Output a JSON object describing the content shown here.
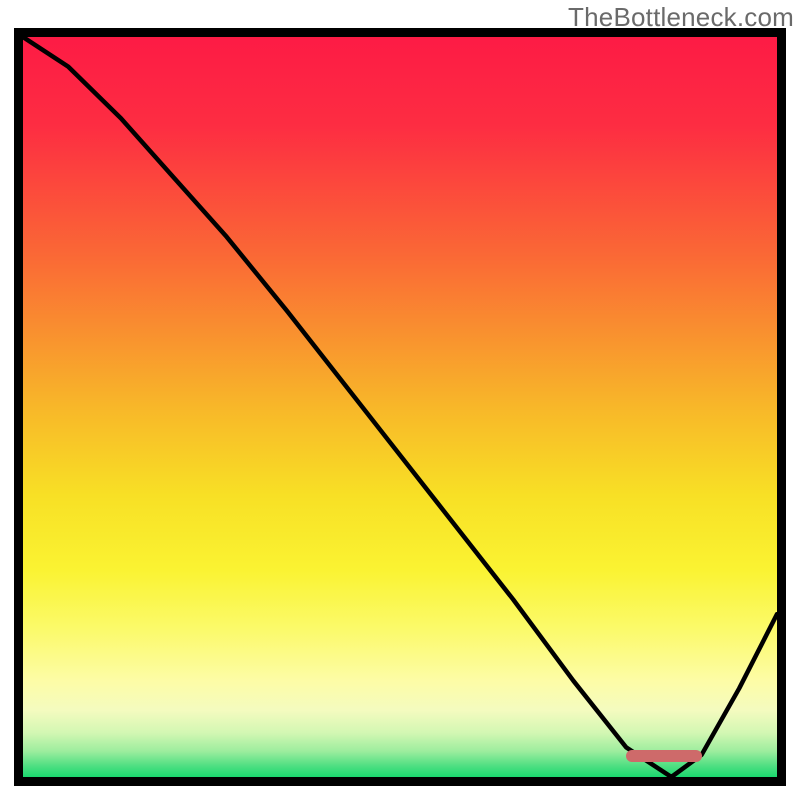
{
  "watermark": "TheBottleneck.com",
  "colors": {
    "frame_border": "#000000",
    "curve_stroke": "#000000",
    "marker_fill": "#ce6a6a",
    "watermark_text": "#6a6a6a"
  },
  "chart_data": {
    "type": "line",
    "title": "",
    "xlabel": "",
    "ylabel": "",
    "xlim": [
      0,
      100
    ],
    "ylim": [
      0,
      100
    ],
    "x": [
      0,
      6,
      13,
      20,
      27,
      35,
      45,
      55,
      65,
      73,
      80,
      86,
      90,
      95,
      100
    ],
    "values": [
      100,
      96,
      89,
      81,
      73,
      63,
      50,
      37,
      24,
      13,
      4,
      0,
      3,
      12,
      22
    ],
    "optimal_range_x": [
      80,
      90
    ],
    "optimal_y_fraction_from_top": 0.972,
    "gradient_stops": [
      {
        "offset": 0.0,
        "color": "#fd1b45"
      },
      {
        "offset": 0.12,
        "color": "#fd2d42"
      },
      {
        "offset": 0.3,
        "color": "#fa6a35"
      },
      {
        "offset": 0.5,
        "color": "#f8b729"
      },
      {
        "offset": 0.62,
        "color": "#f8e025"
      },
      {
        "offset": 0.72,
        "color": "#faf332"
      },
      {
        "offset": 0.8,
        "color": "#fbfa6a"
      },
      {
        "offset": 0.87,
        "color": "#fdfca6"
      },
      {
        "offset": 0.91,
        "color": "#f4fbbf"
      },
      {
        "offset": 0.94,
        "color": "#d3f7b3"
      },
      {
        "offset": 0.965,
        "color": "#9ded9e"
      },
      {
        "offset": 0.985,
        "color": "#4fdf82"
      },
      {
        "offset": 1.0,
        "color": "#1ad86e"
      }
    ]
  }
}
